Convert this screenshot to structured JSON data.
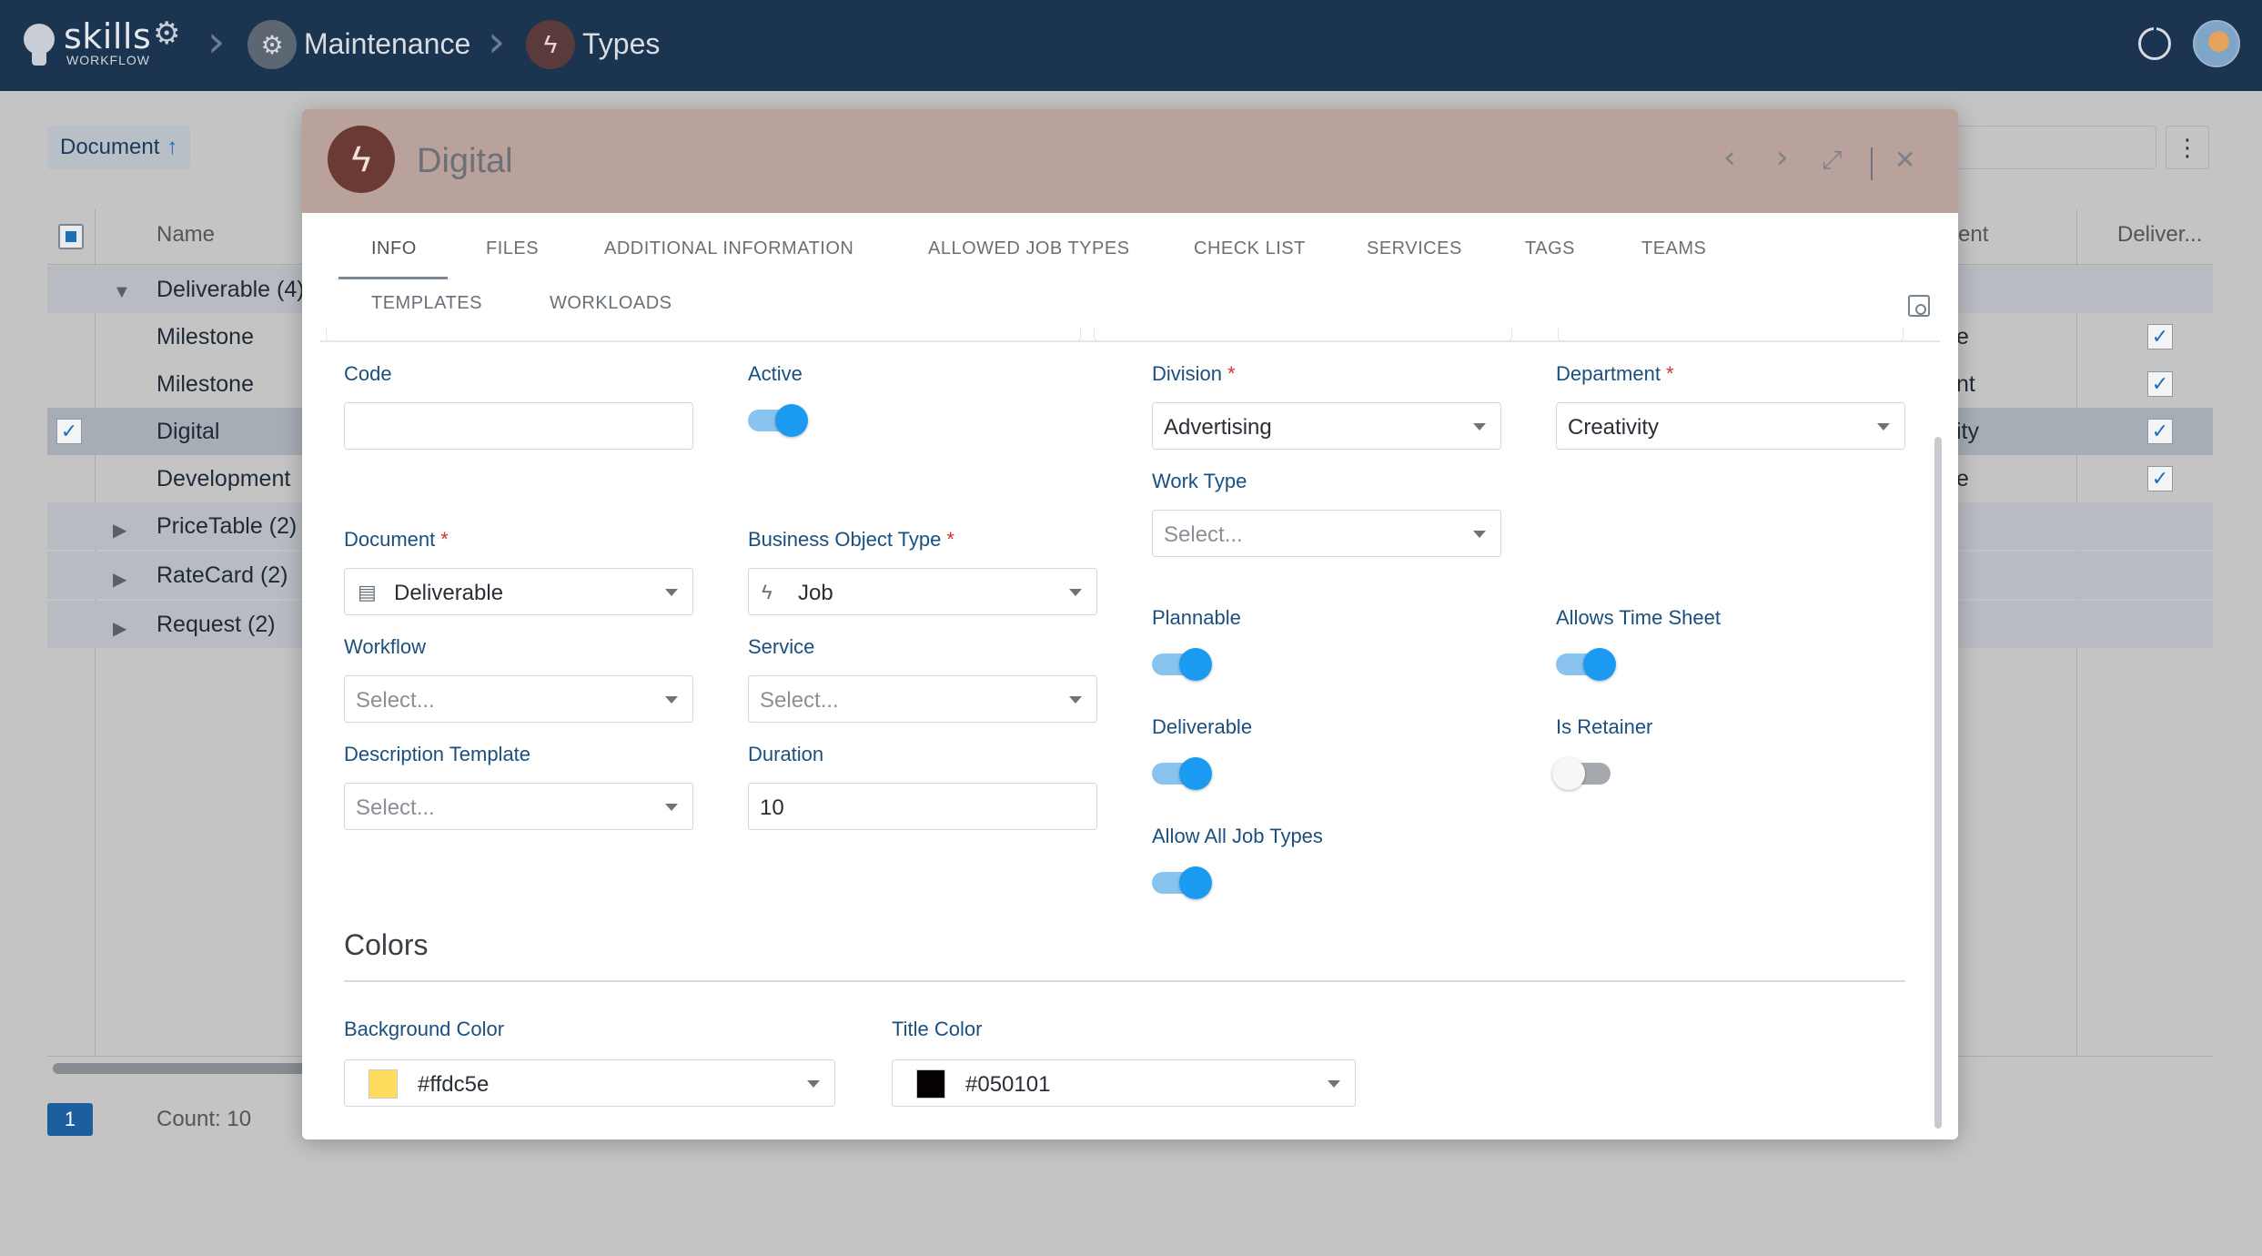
{
  "app": {
    "logo_word": "skills",
    "logo_sub": "WORKFLOW",
    "breadcrumb": [
      {
        "label": "Maintenance",
        "icon": "gears-icon"
      },
      {
        "label": "Types",
        "icon": "bolt-icon"
      }
    ]
  },
  "background_grid": {
    "sort_chip": {
      "label": "Document",
      "icon": "arrow-up-icon"
    },
    "columns": [
      "Name",
      "ent",
      "Deliver..."
    ],
    "rows": [
      {
        "label": "Deliverable (4)",
        "type": "group",
        "expanded": true
      },
      {
        "label": "Milestone",
        "tail": "e",
        "delivered": true
      },
      {
        "label": "Milestone",
        "tail": "nt",
        "delivered": true
      },
      {
        "label": "Digital",
        "tail": "ity",
        "delivered": true,
        "selected": true
      },
      {
        "label": "Development",
        "tail": "e",
        "delivered": true
      },
      {
        "label": "PriceTable (2)",
        "type": "group",
        "expanded": false
      },
      {
        "label": "RateCard (2)",
        "type": "group",
        "expanded": false
      },
      {
        "label": "Request (2)",
        "type": "group",
        "expanded": false
      }
    ],
    "page": "1",
    "count": "Count: 10"
  },
  "modal": {
    "title": "Digital",
    "header_color": "#b9a29b",
    "tabs_row1": [
      "INFO",
      "FILES",
      "ADDITIONAL INFORMATION",
      "ALLOWED JOB TYPES",
      "CHECK LIST",
      "SERVICES",
      "TAGS",
      "TEAMS"
    ],
    "tabs_row2": [
      "TEMPLATES",
      "WORKLOADS"
    ],
    "active_tab": "INFO",
    "fields": {
      "code": {
        "label": "Code",
        "value": ""
      },
      "active": {
        "label": "Active",
        "on": true
      },
      "division": {
        "label": "Division",
        "required": "*",
        "value": "Advertising"
      },
      "department": {
        "label": "Department",
        "required": "*",
        "value": "Creativity"
      },
      "work_type": {
        "label": "Work Type",
        "placeholder": "Select..."
      },
      "document": {
        "label": "Document",
        "required": "*",
        "value": "Deliverable",
        "icon": "document-icon"
      },
      "business_object_type": {
        "label": "Business Object Type",
        "required": "*",
        "value": "Job",
        "icon": "bolt-icon"
      },
      "workflow": {
        "label": "Workflow",
        "placeholder": "Select..."
      },
      "service": {
        "label": "Service",
        "placeholder": "Select..."
      },
      "description_template": {
        "label": "Description Template",
        "placeholder": "Select..."
      },
      "duration": {
        "label": "Duration",
        "value": "10"
      },
      "plannable": {
        "label": "Plannable",
        "on": true
      },
      "allows_time_sheet": {
        "label": "Allows Time Sheet",
        "on": true
      },
      "deliverable": {
        "label": "Deliverable",
        "on": true
      },
      "is_retainer": {
        "label": "Is Retainer",
        "on": false
      },
      "allow_all_job_types": {
        "label": "Allow All Job Types",
        "on": true
      }
    },
    "colors_section": {
      "title": "Colors",
      "background_color": {
        "label": "Background Color",
        "value": "#ffdc5e"
      },
      "title_color": {
        "label": "Title Color",
        "value": "#050101"
      }
    }
  }
}
